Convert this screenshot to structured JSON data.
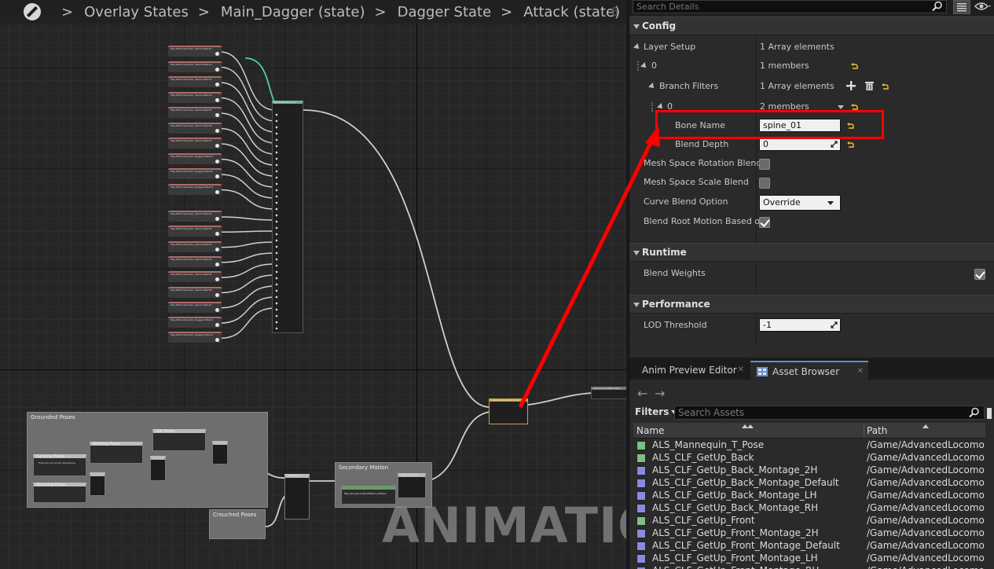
{
  "breadcrumb": {
    "items": [
      "Overlay States",
      "Main_Dagger (state)",
      "Dagger State",
      "Attack (state)"
    ],
    "zoom_partial": "6"
  },
  "graph": {
    "comments": {
      "grounded": "Grounded Poses",
      "secondary": "Secondary Motion",
      "crouched": "Crouched Poses"
    },
    "nodes": {
      "blend_poses": "Blend Poses by int",
      "layered_blend": "Layered blend per bone",
      "output_pose": "Output Animation Pose",
      "running": "Running Poses",
      "walking": "Walking Poses",
      "idle": "Idle Poses",
      "standing": "Standing Poses",
      "apply_additive": "Apply Additive",
      "blend_bool": "Blend Bool",
      "play_secondary": "Play ALS_SecondaryMotion additive",
      "evaluate": "Evaluate ALS_Poses_BasePoses"
    },
    "pose_labels": [
      "Play RPG-Character_Sword-Attack1",
      "Play RPG-Character_Sword-Attack2",
      "Play RPG-Character_Sword-Attack3",
      "Play RPG-Character_Sword-Attack4",
      "Play RPG-Character_Sword-Attack5",
      "Play RPG-Character_Sword-Attack6",
      "Play RPG-Character_Sword-Attack7",
      "Play RPG-Character_Dagger-Attack1",
      "Play RPG-Character_Dagger-Attack2",
      "Play RPG-Character_Dagger-Attack3"
    ],
    "watermark": "ANIMATION"
  },
  "details": {
    "search_placeholder": "Search Details",
    "sections": {
      "config": "Config",
      "runtime": "Runtime",
      "performance": "Performance"
    },
    "rows": {
      "layer_setup": {
        "label": "Layer Setup",
        "value": "1 Array elements"
      },
      "index0": {
        "label": "0",
        "value": "1 members"
      },
      "branch_filters": {
        "label": "Branch Filters",
        "value": "1 Array elements"
      },
      "index0b": {
        "label": "0",
        "value": "2 members"
      },
      "bone_name": {
        "label": "Bone Name",
        "value": "spine_01"
      },
      "blend_depth": {
        "label": "Blend Depth",
        "value": "0"
      },
      "mesh_rot": {
        "label": "Mesh Space Rotation Blend",
        "checked": false
      },
      "mesh_scale": {
        "label": "Mesh Space Scale Blend",
        "checked": false
      },
      "curve_blend": {
        "label": "Curve Blend Option",
        "value": "Override"
      },
      "root_motion": {
        "label": "Blend Root Motion Based on",
        "checked": true
      },
      "blend_weights": {
        "label": "Blend Weights",
        "checked": true
      },
      "lod_threshold": {
        "label": "LOD Threshold",
        "value": "-1"
      }
    }
  },
  "bottom_panel": {
    "tabs": [
      "Anim Preview Editor",
      "Asset Browser"
    ],
    "filters_label": "Filters",
    "search_placeholder": "Search Assets",
    "columns": [
      "Name",
      "Path"
    ],
    "assets": [
      {
        "name": "ALS_Mannequin_T_Pose",
        "path": "/Game/AdvancedLocomoti",
        "type": "anim"
      },
      {
        "name": "ALS_CLF_GetUp_Back",
        "path": "/Game/AdvancedLocomoti",
        "type": "anim"
      },
      {
        "name": "ALS_CLF_GetUp_Back_Montage_2H",
        "path": "/Game/AdvancedLocomoti",
        "type": "montage"
      },
      {
        "name": "ALS_CLF_GetUp_Back_Montage_Default",
        "path": "/Game/AdvancedLocomoti",
        "type": "montage"
      },
      {
        "name": "ALS_CLF_GetUp_Back_Montage_LH",
        "path": "/Game/AdvancedLocomoti",
        "type": "montage"
      },
      {
        "name": "ALS_CLF_GetUp_Back_Montage_RH",
        "path": "/Game/AdvancedLocomoti",
        "type": "montage"
      },
      {
        "name": "ALS_CLF_GetUp_Front",
        "path": "/Game/AdvancedLocomoti",
        "type": "anim"
      },
      {
        "name": "ALS_CLF_GetUp_Front_Montage_2H",
        "path": "/Game/AdvancedLocomoti",
        "type": "montage"
      },
      {
        "name": "ALS_CLF_GetUp_Front_Montage_Default",
        "path": "/Game/AdvancedLocomoti",
        "type": "montage"
      },
      {
        "name": "ALS_CLF_GetUp_Front_Montage_LH",
        "path": "/Game/AdvancedLocomoti",
        "type": "montage"
      },
      {
        "name": "ALS_CLF_GetUp_Front_Montage_RH",
        "path": "/Game/AdvancedLocomoti",
        "type": "montage"
      }
    ]
  },
  "colors": {
    "annotation": "#ff0000",
    "anim_icon": "#7fbf7f",
    "montage_icon": "#8a8ae0",
    "wire": "#cfcfcf",
    "wire_green": "#4fd1a0"
  }
}
